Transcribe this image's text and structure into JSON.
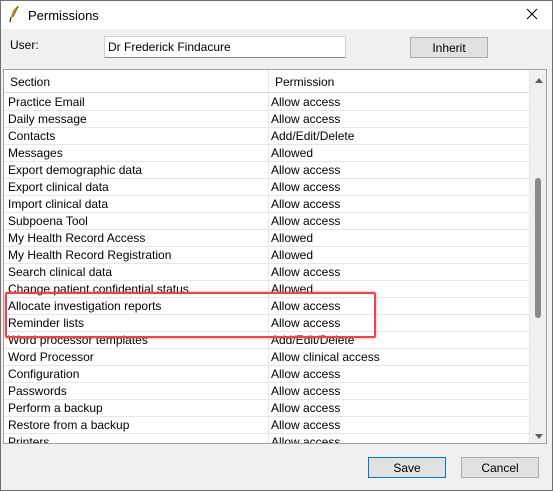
{
  "window": {
    "title": "Permissions",
    "icons": {
      "app": "feather-pen-icon",
      "close": "close-icon"
    }
  },
  "user": {
    "label": "User:",
    "value": "Dr Frederick Findacure"
  },
  "buttons": {
    "inherit": "Inherit",
    "save": "Save",
    "cancel": "Cancel"
  },
  "grid": {
    "columns": [
      "Section",
      "Permission"
    ],
    "rows": [
      {
        "section": "Practice Email",
        "permission": "Allow access"
      },
      {
        "section": "Daily message",
        "permission": "Allow access"
      },
      {
        "section": "Contacts",
        "permission": "Add/Edit/Delete"
      },
      {
        "section": "Messages",
        "permission": "Allowed"
      },
      {
        "section": "Export demographic data",
        "permission": "Allow access"
      },
      {
        "section": "Export clinical data",
        "permission": "Allow access"
      },
      {
        "section": "Import clinical data",
        "permission": "Allow access"
      },
      {
        "section": "Subpoena Tool",
        "permission": "Allow access"
      },
      {
        "section": "My Health Record Access",
        "permission": "Allowed"
      },
      {
        "section": "My Health Record Registration",
        "permission": "Allowed"
      },
      {
        "section": "Search clinical data",
        "permission": "Allow access"
      },
      {
        "section": "Change patient confidential status",
        "permission": "Allowed"
      },
      {
        "section": "Allocate investigation reports",
        "permission": "Allow access"
      },
      {
        "section": "Reminder lists",
        "permission": "Allow access"
      },
      {
        "section": "Word processor templates",
        "permission": "Add/Edit/Delete"
      },
      {
        "section": "Word Processor",
        "permission": "Allow clinical access"
      },
      {
        "section": "Configuration",
        "permission": "Allow access"
      },
      {
        "section": "Passwords",
        "permission": "Allow access"
      },
      {
        "section": "Perform a backup",
        "permission": "Allow access"
      },
      {
        "section": "Restore from a backup",
        "permission": "Allow access"
      },
      {
        "section": "Printers",
        "permission": "Allow access"
      }
    ],
    "highlight_color": "#e8454f"
  }
}
